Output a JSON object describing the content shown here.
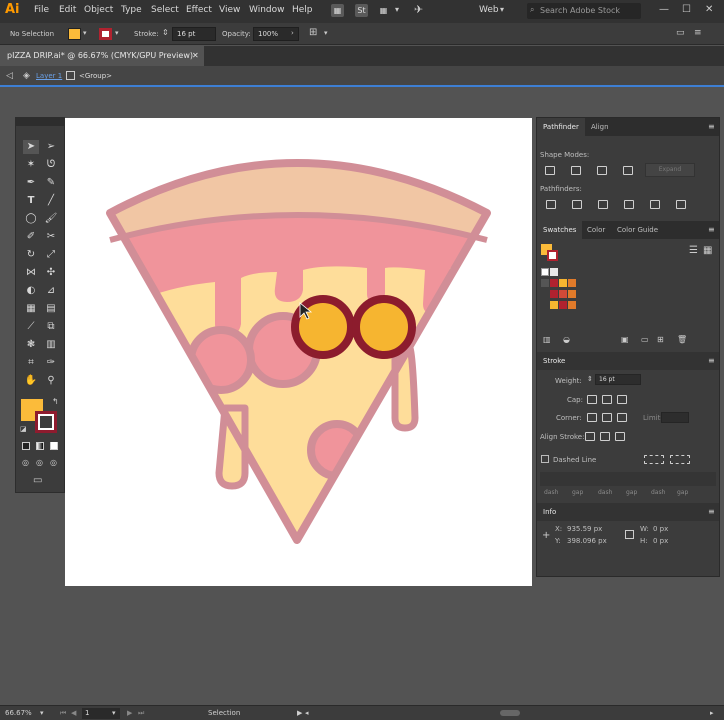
{
  "app": {
    "logo": "Ai"
  },
  "menu": [
    "File",
    "Edit",
    "Object",
    "Type",
    "Select",
    "Effect",
    "View",
    "Window",
    "Help"
  ],
  "toolbar": {
    "stock_label": "St",
    "workspace": "Web",
    "search_placeholder": "Search Adobe Stock"
  },
  "control": {
    "selection_status": "No Selection",
    "stroke_label": "Stroke:",
    "stroke_weight": "16 pt",
    "opacity_label": "Opacity:",
    "opacity_value": "100%"
  },
  "document": {
    "tab_title": "pIZZA DRIP.ai* @ 66.67% (CMYK/GPU Preview)",
    "close": "✕"
  },
  "breadcrumb": {
    "layer": "Layer 1",
    "group": "<Group>"
  },
  "panels": {
    "pathfinder_tabs": [
      "Pathfinder",
      "Align"
    ],
    "shape_modes_label": "Shape Modes:",
    "expand_label": "Expand",
    "pathfinders_label": "Pathfinders:",
    "swatch_tabs": [
      "Swatches",
      "Color",
      "Color Guide"
    ],
    "stroke": {
      "title": "Stroke",
      "weight_label": "Weight:",
      "weight_value": "16 pt",
      "cap_label": "Cap:",
      "corner_label": "Corner:",
      "limit_label": "Limit:",
      "align_label": "Align Stroke:",
      "dashed_label": "Dashed Line",
      "dash_labels": [
        "dash",
        "gap",
        "dash",
        "gap",
        "dash",
        "gap"
      ]
    },
    "info": {
      "title": "Info",
      "x_label": "X:",
      "x_value": "935.59 px",
      "y_label": "Y:",
      "y_value": "398.096 px",
      "w_label": "W:",
      "w_value": "0 px",
      "h_label": "H:",
      "h_value": "0 px"
    }
  },
  "status": {
    "zoom": "66.67%",
    "page": "1",
    "tool": "Selection"
  },
  "colors": {
    "fill": "#fbbb3a",
    "stroke": "#8e1b2e",
    "crust": "#f1c6a4",
    "sauce": "#f0949b",
    "cheese": "#fedd9a",
    "outline": "#d18e97",
    "eye": "#f6b530",
    "eye_ring": "#8c1c2d",
    "accent": "#ff9a00"
  }
}
